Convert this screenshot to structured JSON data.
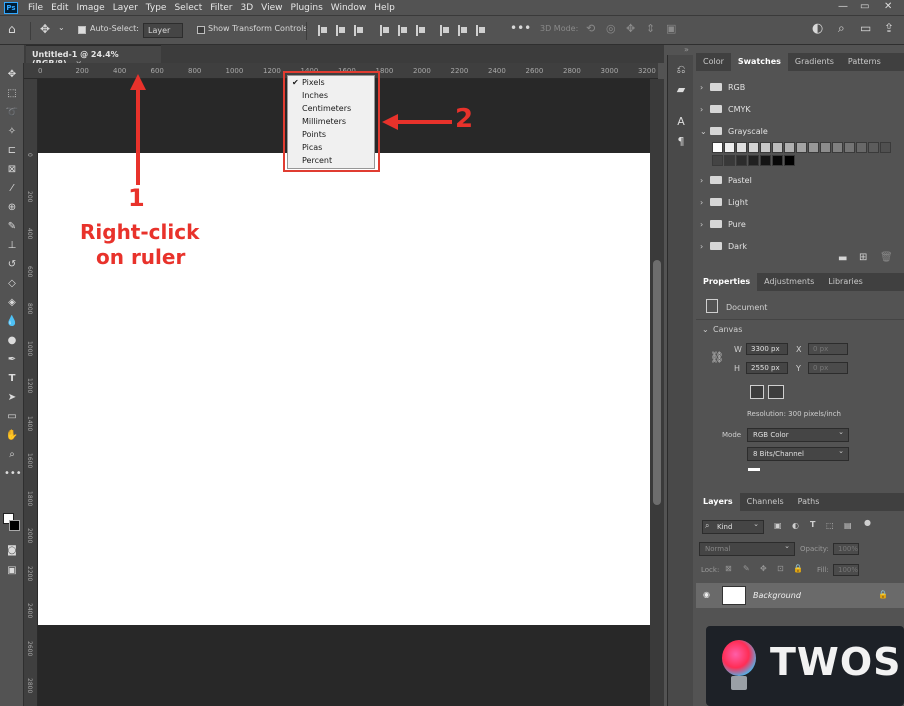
{
  "menubar": {
    "logo": "Ps",
    "items": [
      "File",
      "Edit",
      "Image",
      "Layer",
      "Type",
      "Select",
      "Filter",
      "3D",
      "View",
      "Plugins",
      "Window",
      "Help"
    ],
    "window_controls": [
      "—",
      "▭",
      "✕"
    ]
  },
  "options": {
    "auto_select_label": "Auto-Select:",
    "auto_select_value": "Layer",
    "transform_label": "Show Transform Controls",
    "mode_label": "3D Mode:",
    "more": "•••"
  },
  "document": {
    "tab_title": "Untitled-1 @ 24.4% (RGB/8)",
    "tab_close": "×"
  },
  "ruler": {
    "h_ticks": [
      "0",
      "200",
      "400",
      "600",
      "800",
      "1000",
      "1200",
      "1400",
      "1600",
      "1800",
      "2000",
      "2200",
      "2400",
      "2600",
      "2800",
      "3000",
      "3200"
    ],
    "v_ticks": [
      "0",
      "200",
      "400",
      "600",
      "800",
      "1000",
      "1200",
      "1400",
      "1600",
      "1800",
      "2000",
      "2200",
      "2400",
      "2600",
      "2800",
      "3000"
    ]
  },
  "context_menu": {
    "items": [
      "Pixels",
      "Inches",
      "Centimeters",
      "Millimeters",
      "Points",
      "Picas",
      "Percent"
    ],
    "checked": "Pixels",
    "check_mark": "✔"
  },
  "annotations": {
    "step1_number": "1",
    "step1_line1": "Right-click",
    "step1_line2": "on ruler",
    "step2_number": "2",
    "color": "#e8322b"
  },
  "swatches_panel": {
    "tabs": [
      "Color",
      "Swatches",
      "Gradients",
      "Patterns"
    ],
    "active_tab": "Swatches",
    "folders": [
      "RGB",
      "CMYK",
      "Grayscale",
      "Pastel",
      "Light",
      "Pure",
      "Dark"
    ],
    "grayscale_row1": [
      "#ffffff",
      "#eeeeee",
      "#e0e0e0",
      "#d4d4d4",
      "#c8c8c8",
      "#bcbcbc",
      "#b0b0b0",
      "#a4a4a4",
      "#989898",
      "#8c8c8c",
      "#808080",
      "#747474",
      "#686868",
      "#5c5c5c",
      "#505050"
    ],
    "grayscale_row2": [
      "#444444",
      "#383838",
      "#2c2c2c",
      "#202020",
      "#141414",
      "#080808",
      "#000000"
    ]
  },
  "properties_panel": {
    "tabs": [
      "Properties",
      "Adjustments",
      "Libraries"
    ],
    "active_tab": "Properties",
    "type": "Document",
    "section": "Canvas",
    "w_label": "W",
    "w_value": "3300 px",
    "h_label": "H",
    "h_value": "2550 px",
    "x_label": "X",
    "x_value": "0 px",
    "y_label": "Y",
    "y_value": "0 px",
    "resolution": "Resolution: 300 pixels/inch",
    "mode_label": "Mode",
    "mode_value": "RGB Color",
    "depth_value": "8 Bits/Channel"
  },
  "layers_panel": {
    "tabs": [
      "Layers",
      "Channels",
      "Paths"
    ],
    "active_tab": "Layers",
    "filter_label": "Kind",
    "blend_mode": "Normal",
    "opacity_label": "Opacity:",
    "opacity_value": "100%",
    "lock_label": "Lock:",
    "fill_label": "Fill:",
    "fill_value": "100%",
    "layer_name": "Background"
  },
  "watermark": {
    "text": "TWOS"
  }
}
